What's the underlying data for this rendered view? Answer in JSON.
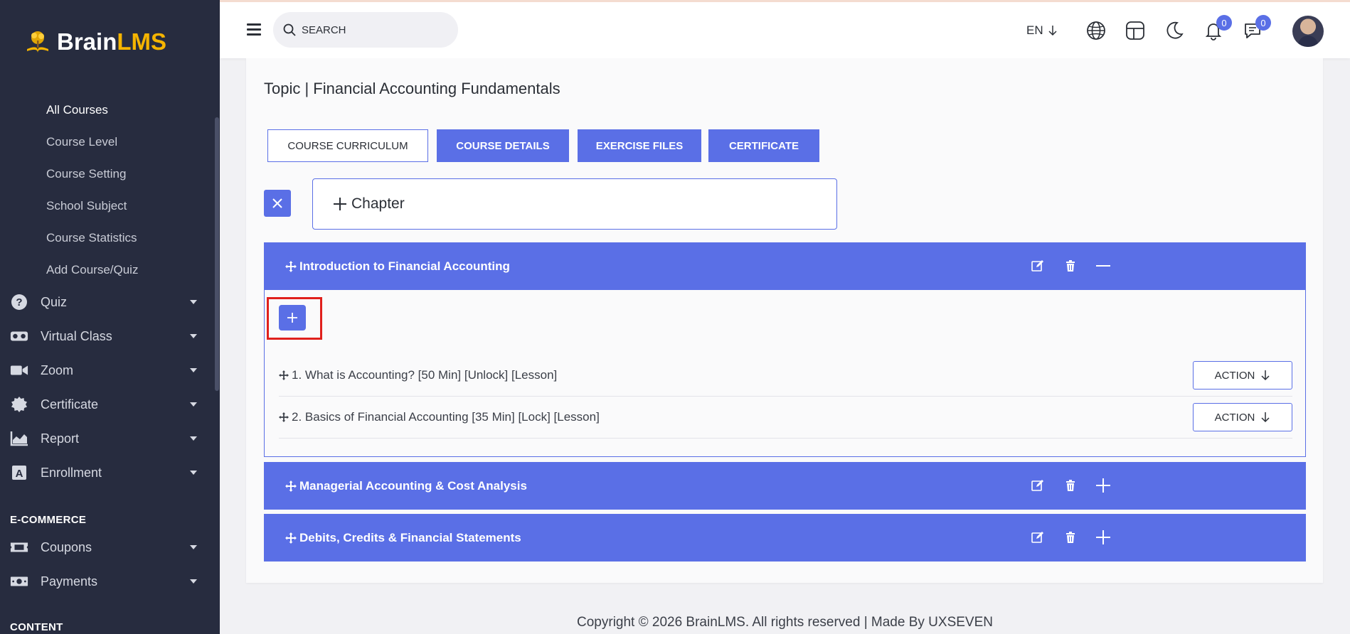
{
  "brand": {
    "name_a": "Brain",
    "name_b": "LMS"
  },
  "sidebar": {
    "sub_items": [
      "All Courses",
      "Course Level",
      "Course Setting",
      "School Subject",
      "Course Statistics",
      "Add Course/Quiz"
    ],
    "items": [
      {
        "label": "Quiz",
        "icon": "question-circle-icon"
      },
      {
        "label": "Virtual Class",
        "icon": "vr-headset-icon"
      },
      {
        "label": "Zoom",
        "icon": "video-camera-icon"
      },
      {
        "label": "Certificate",
        "icon": "certificate-badge-icon"
      },
      {
        "label": "Report",
        "icon": "area-chart-icon"
      },
      {
        "label": "Enrollment",
        "icon": "letter-a-box-icon"
      }
    ],
    "sections": {
      "ecommerce": "E-COMMERCE",
      "content": "CONTENT"
    },
    "ecommerce_items": [
      {
        "label": "Coupons",
        "icon": "ticket-icon"
      },
      {
        "label": "Payments",
        "icon": "money-bill-icon"
      }
    ]
  },
  "topbar": {
    "search_placeholder": "SEARCH",
    "language": "EN",
    "notifications_count": "0",
    "messages_count": "0"
  },
  "page": {
    "title": "Topic | Financial Accounting Fundamentals",
    "tabs": [
      "COURSE CURRICULUM",
      "COURSE DETAILS",
      "EXERCISE FILES",
      "CERTIFICATE"
    ],
    "add_chapter_label": "Chapter"
  },
  "chapters": [
    {
      "title": "Introduction to Financial Accounting",
      "expanded": true,
      "lessons": [
        {
          "label": "1. What is Accounting? [50 Min] [Unlock] [Lesson]",
          "action": "ACTION"
        },
        {
          "label": "2. Basics of Financial Accounting [35 Min] [Lock] [Lesson]",
          "action": "ACTION"
        }
      ]
    },
    {
      "title": "Managerial Accounting & Cost Analysis",
      "expanded": false
    },
    {
      "title": "Debits, Credits & Financial Statements",
      "expanded": false
    }
  ],
  "footer": "Copyright © 2026 BrainLMS. All rights reserved | Made By UXSEVEN",
  "colors": {
    "accent": "#5a6fe6",
    "sidebar_bg": "#272c3f",
    "highlight": "#e0201c",
    "brand_yellow": "#f5b400"
  }
}
